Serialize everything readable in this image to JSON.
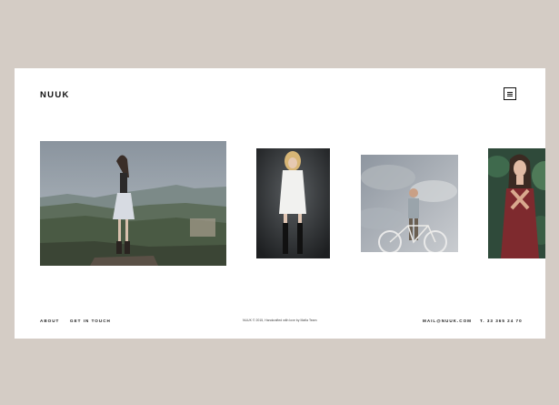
{
  "header": {
    "logo": "NUUK",
    "menu_icon": "hamburger-menu-icon"
  },
  "gallery": {
    "photos": [
      {
        "name": "woman-on-cliff-photo",
        "alt": "Woman standing on a cliff above a misty valley"
      },
      {
        "name": "woman-white-dress-photo",
        "alt": "Woman in white dress and black boots"
      },
      {
        "name": "man-with-bicycle-photo",
        "alt": "Man with a bicycle under a cloudy sky"
      },
      {
        "name": "woman-red-dress-photo",
        "alt": "Woman in red dress in front of leaves"
      }
    ]
  },
  "footer": {
    "about": "ABOUT",
    "get_in_touch": "GET IN TOUCH",
    "credit": "NUUK © 2015, Handcrafted with love by Mafia Team",
    "email": "MAIL@NUUK.COM",
    "phone": "T. 33 365 24 70"
  },
  "colors": {
    "background": "#d4ccc5",
    "page": "#ffffff",
    "text": "#111111"
  }
}
